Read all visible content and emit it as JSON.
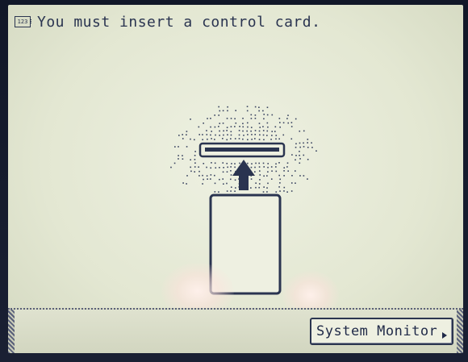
{
  "header": {
    "counter_icon_text": "123",
    "message": "You must insert a control card."
  },
  "illustration": {
    "slot_icon": "card-slot-icon",
    "arrow_icon": "up-arrow-icon",
    "card_icon": "control-card-icon"
  },
  "footer": {
    "system_monitor_label": "System Monitor"
  },
  "colors": {
    "screen": "#e3e7d2",
    "ink": "#2a3450",
    "bezel": "#111728"
  }
}
